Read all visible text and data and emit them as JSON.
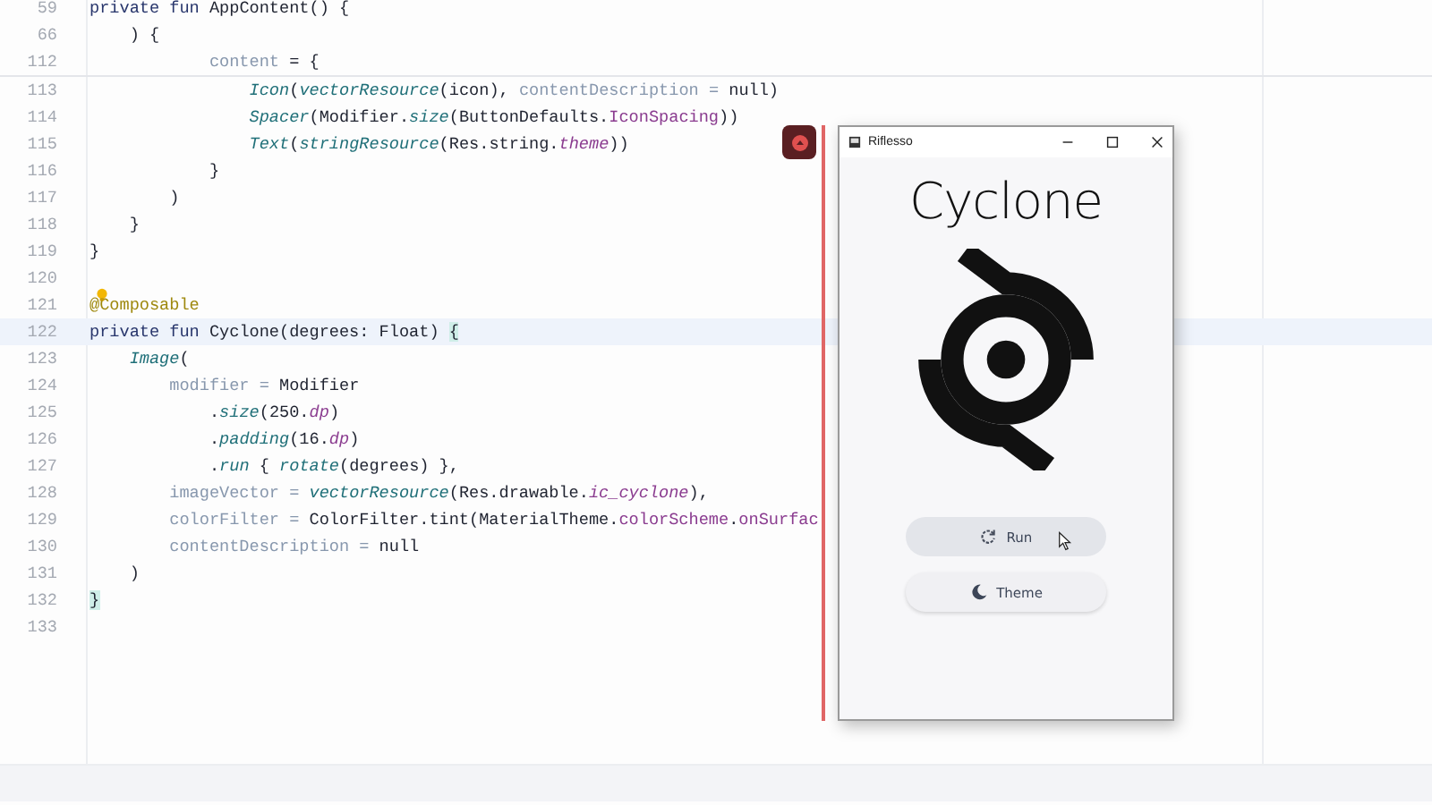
{
  "editor": {
    "sticky_lines": [
      {
        "number": "59",
        "current": false,
        "tokens": [
          {
            "kind": "kw",
            "text": "private fun "
          },
          {
            "kind": "plain",
            "text": "AppContent() {"
          }
        ]
      },
      {
        "number": "66",
        "current": false,
        "tokens": [
          {
            "kind": "plain",
            "text": "    ) {"
          }
        ]
      },
      {
        "number": "112",
        "current": false,
        "tokens": [
          {
            "kind": "param",
            "text": "            content"
          },
          {
            "kind": "plain",
            "text": " = {"
          }
        ]
      }
    ],
    "lines": [
      {
        "number": "113",
        "current": false,
        "tokens": [
          {
            "kind": "call",
            "text": "                Icon"
          },
          {
            "kind": "plain",
            "text": "("
          },
          {
            "kind": "call",
            "text": "vectorResource"
          },
          {
            "kind": "plain",
            "text": "(icon), "
          },
          {
            "kind": "param",
            "text": "contentDescription = "
          },
          {
            "kind": "plain",
            "text": "null)"
          }
        ]
      },
      {
        "number": "114",
        "current": false,
        "tokens": [
          {
            "kind": "call",
            "text": "                Spacer"
          },
          {
            "kind": "plain",
            "text": "(Modifier."
          },
          {
            "kind": "call",
            "text": "size"
          },
          {
            "kind": "plain",
            "text": "(ButtonDefaults."
          },
          {
            "kind": "prop",
            "text": "IconSpacing"
          },
          {
            "kind": "plain",
            "text": "))"
          }
        ]
      },
      {
        "number": "115",
        "current": false,
        "tokens": [
          {
            "kind": "call",
            "text": "                Text"
          },
          {
            "kind": "plain",
            "text": "("
          },
          {
            "kind": "call",
            "text": "stringResource"
          },
          {
            "kind": "plain",
            "text": "(Res.string."
          },
          {
            "kind": "ext",
            "text": "theme"
          },
          {
            "kind": "plain",
            "text": "))"
          }
        ]
      },
      {
        "number": "116",
        "current": false,
        "tokens": [
          {
            "kind": "plain",
            "text": "            }"
          }
        ]
      },
      {
        "number": "117",
        "current": false,
        "tokens": [
          {
            "kind": "plain",
            "text": "        )"
          }
        ]
      },
      {
        "number": "118",
        "current": false,
        "tokens": [
          {
            "kind": "plain",
            "text": "    }"
          }
        ]
      },
      {
        "number": "119",
        "current": false,
        "tokens": [
          {
            "kind": "plain",
            "text": "}"
          }
        ]
      },
      {
        "number": "120",
        "current": false
      },
      {
        "number": "121",
        "current": false,
        "tokens": [
          {
            "kind": "annot",
            "text": "@Composable"
          }
        ]
      },
      {
        "number": "122",
        "current": true,
        "tokens": [
          {
            "kind": "kw",
            "text": "private fun "
          },
          {
            "kind": "plain",
            "text": "Cyclone(degrees: Float) "
          },
          {
            "kind": "brace",
            "text": "{"
          }
        ]
      },
      {
        "number": "123",
        "current": false,
        "tokens": [
          {
            "kind": "call",
            "text": "    Image"
          },
          {
            "kind": "plain",
            "text": "("
          }
        ]
      },
      {
        "number": "124",
        "current": false,
        "tokens": [
          {
            "kind": "param",
            "text": "        modifier = "
          },
          {
            "kind": "plain",
            "text": "Modifier"
          }
        ]
      },
      {
        "number": "125",
        "current": false,
        "tokens": [
          {
            "kind": "plain",
            "text": "            ."
          },
          {
            "kind": "call",
            "text": "size"
          },
          {
            "kind": "plain",
            "text": "(250."
          },
          {
            "kind": "ext",
            "text": "dp"
          },
          {
            "kind": "plain",
            "text": ")"
          }
        ]
      },
      {
        "number": "126",
        "current": false,
        "tokens": [
          {
            "kind": "plain",
            "text": "            ."
          },
          {
            "kind": "call",
            "text": "padding"
          },
          {
            "kind": "plain",
            "text": "(16."
          },
          {
            "kind": "ext",
            "text": "dp"
          },
          {
            "kind": "plain",
            "text": ")"
          }
        ]
      },
      {
        "number": "127",
        "current": false,
        "tokens": [
          {
            "kind": "plain",
            "text": "            ."
          },
          {
            "kind": "call",
            "text": "run"
          },
          {
            "kind": "plain",
            "text": " { "
          },
          {
            "kind": "call",
            "text": "rotate"
          },
          {
            "kind": "plain",
            "text": "(degrees) },"
          }
        ]
      },
      {
        "number": "128",
        "current": false,
        "tokens": [
          {
            "kind": "param",
            "text": "        imageVector = "
          },
          {
            "kind": "call",
            "text": "vectorResource"
          },
          {
            "kind": "plain",
            "text": "(Res.drawable."
          },
          {
            "kind": "ext",
            "text": "ic_cyclone"
          },
          {
            "kind": "plain",
            "text": "),"
          }
        ]
      },
      {
        "number": "129",
        "current": false,
        "tokens": [
          {
            "kind": "param",
            "text": "        colorFilter = "
          },
          {
            "kind": "plain",
            "text": "ColorFilter.tint(MaterialTheme."
          },
          {
            "kind": "prop",
            "text": "colorScheme"
          },
          {
            "kind": "plain",
            "text": "."
          },
          {
            "kind": "prop",
            "text": "onSurfac"
          }
        ]
      },
      {
        "number": "130",
        "current": false,
        "tokens": [
          {
            "kind": "param",
            "text": "        contentDescription = "
          },
          {
            "kind": "plain",
            "text": "null"
          }
        ]
      },
      {
        "number": "131",
        "current": false,
        "tokens": [
          {
            "kind": "plain",
            "text": "    )"
          }
        ]
      },
      {
        "number": "132",
        "current": false,
        "tokens": [
          {
            "kind": "brace",
            "text": "}"
          }
        ]
      },
      {
        "number": "133",
        "current": false
      }
    ]
  },
  "app_window": {
    "title": "Riflesso",
    "heading": "Cyclone",
    "buttons": [
      {
        "label": "Run",
        "hovered": true
      },
      {
        "label": "Theme",
        "hovered": false
      }
    ]
  }
}
